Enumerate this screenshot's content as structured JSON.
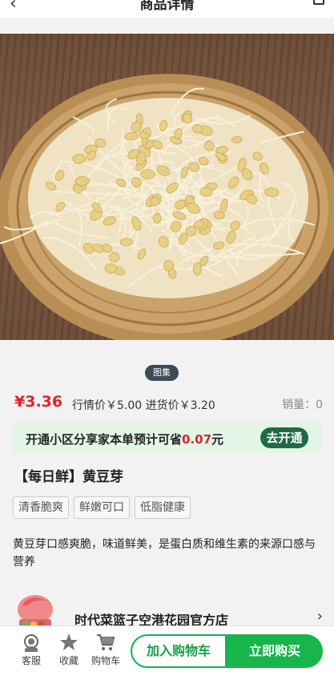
{
  "header": {
    "title": "商品详情",
    "back_icon": "chevron-left-icon",
    "share_icon": "share-icon"
  },
  "gallery": {
    "badge": "图集",
    "image": "soybean-sprouts-in-basket"
  },
  "pricing": {
    "price": "¥3.36",
    "market_price": "行情价￥5.00",
    "purchase_price": "进货价￥3.20",
    "sales_label": "销量：",
    "sales_count": "0"
  },
  "promo": {
    "text_before": "开通小区分享家本单预计可省",
    "saving": "0.07",
    "text_after": "元",
    "button": "去开通"
  },
  "product": {
    "name": "【每日鲜】黄豆芽",
    "tags": [
      "清香脆爽",
      "鲜嫩可口",
      "低脂健康"
    ],
    "description": "黄豆芽口感爽脆，味道鲜美，是蛋白质和维生素的来源口感与营养"
  },
  "shop": {
    "name": "时代菜篮子空港花园官方店",
    "arrow_icon": "chevron-right-icon"
  },
  "bottom_bar": {
    "service": "客服",
    "favorite": "收藏",
    "cart": "购物车",
    "add_to_cart": "加入购物车",
    "buy_now": "立即购买"
  },
  "colors": {
    "accent_green": "#18b54b",
    "price_red": "#e0232b",
    "promo_bg": "#e2f5e6",
    "dark_green": "#1f6b45"
  }
}
